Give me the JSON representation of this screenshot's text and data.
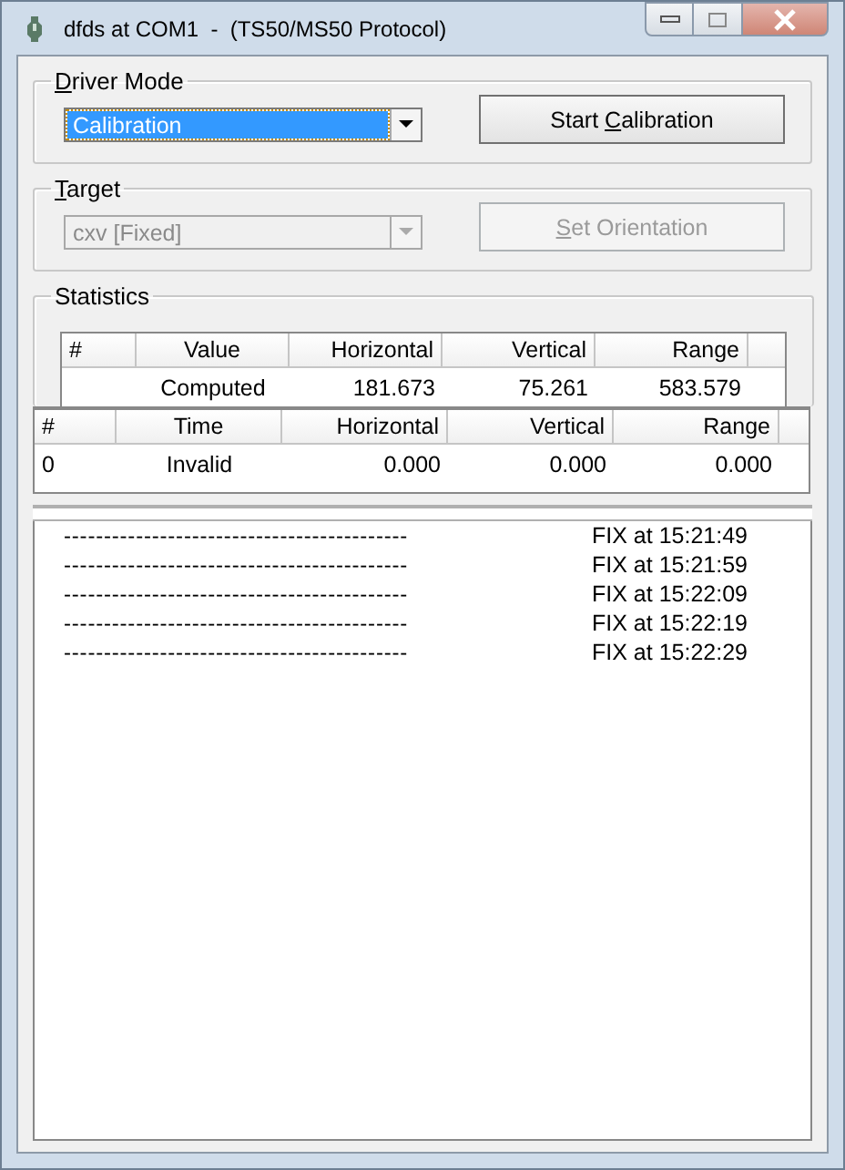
{
  "window": {
    "title": "dfds at COM1  -  (TS50/MS50 Protocol)"
  },
  "driver_mode": {
    "label": {
      "key": "D",
      "after": "river Mode"
    },
    "combo": {
      "value": "Calibration",
      "focused": true,
      "disabled": false
    },
    "button": {
      "label": {
        "before": "Start ",
        "key": "C",
        "after": "alibration"
      },
      "disabled": false
    }
  },
  "target": {
    "label": {
      "key": "T",
      "after": "arget"
    },
    "combo": {
      "value": "cxv [Fixed]",
      "focused": false,
      "disabled": true
    },
    "button": {
      "label": {
        "key": "S",
        "after": "et Orientation"
      },
      "disabled": true
    }
  },
  "statistics": {
    "label": "Statistics",
    "summary_table": {
      "columns": [
        "#",
        "Value",
        "Horizontal",
        "Vertical",
        "Range"
      ],
      "rows": [
        [
          null,
          "Computed",
          "181.673",
          "75.261",
          "583.579"
        ]
      ]
    },
    "readings_table": {
      "columns": [
        "#",
        "Time",
        "Horizontal",
        "Vertical",
        "Range"
      ],
      "rows": [
        [
          "0",
          "Invalid",
          "0.000",
          "0.000",
          "0.000"
        ]
      ]
    }
  },
  "log": [
    {
      "dashes": "-------------------------------------------",
      "text": "FIX at 15:21:49"
    },
    {
      "dashes": "-------------------------------------------",
      "text": "FIX at 15:21:59"
    },
    {
      "dashes": "-------------------------------------------",
      "text": "FIX at 15:22:09"
    },
    {
      "dashes": "-------------------------------------------",
      "text": "FIX at 15:22:19"
    },
    {
      "dashes": "-------------------------------------------",
      "text": "FIX at 15:22:29"
    }
  ]
}
